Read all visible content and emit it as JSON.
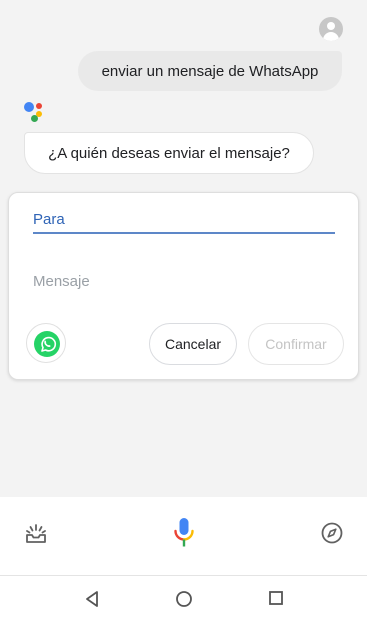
{
  "conversation": {
    "user_query": "enviar un mensaje de WhatsApp",
    "assistant_reply": "¿A quién deseas enviar el mensaje?"
  },
  "compose_card": {
    "to_placeholder": "Para",
    "message_placeholder": "Mensaje",
    "app_icon": "whatsapp-icon",
    "cancel_label": "Cancelar",
    "confirm_label": "Confirmar"
  },
  "toolbar": {
    "left_icon": "updates-tray-icon",
    "center_icon": "microphone-icon",
    "right_icon": "compass-icon"
  },
  "navigation": {
    "back_icon": "back-triangle-icon",
    "home_icon": "home-circle-icon",
    "recents_icon": "recents-square-icon"
  },
  "colors": {
    "accent_blue": "#4285f4",
    "whatsapp_green": "#25d366",
    "mic_red": "#ea4335",
    "mic_yellow": "#fbbc05"
  }
}
